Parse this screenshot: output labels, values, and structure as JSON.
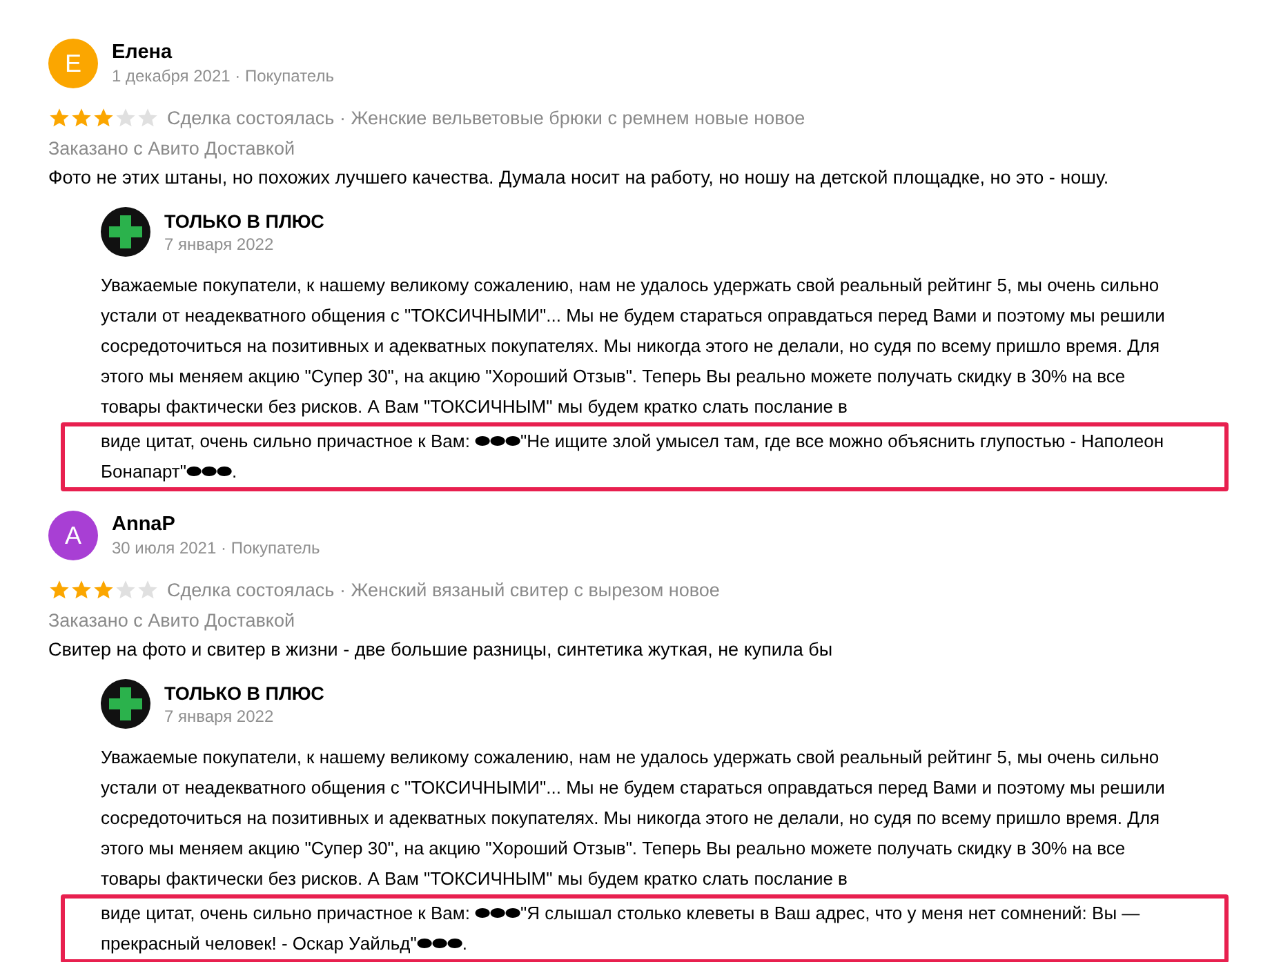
{
  "reviews": [
    {
      "author": "Елена",
      "initial": "Е",
      "color": "#fba600",
      "meta": "1 декабря 2021 · Покупатель",
      "stars": 3,
      "deal": "Сделка состоялась · Женские вельветовые брюки с ремнем новые новое",
      "delivery": "Заказано с Авито Доставкой",
      "text": "Фото не этих штаны, но похожих лучшего качества. Думала носит на работу, но ношу на детской площадке, но это - ношу.",
      "reply": {
        "author": "ТОЛЬКО В ПЛЮС",
        "date": "7 января 2022",
        "text": "Уважаемые покупатели, к нашему великому сожалению, нам не удалось удержать свой реальный рейтинг 5, мы очень сильно устали от неадекватного общения с \"ТОКСИЧНЫМИ\"... Мы не будем стараться оправдаться перед Вами и поэтому мы решили сосредоточиться на позитивных и адекватных покупателях. Мы никогда этого не делали, но судя по всему пришло время. Для этого мы меняем акцию \"Супер 30\", на акцию \"Хороший Отзыв\". Теперь Вы реально можете получать скидку в 30% на все товары фактически без рисков. А Вам \"ТОКСИЧНЫМ\" мы будем кратко слать послание в",
        "highlight": "виде цитат, очень сильно причастное к Вам: ⬬⬬⬬\"Не ищите злой умысел там, где все можно объяснить глупостью - Наполеон Бонапарт\"⬬⬬⬬."
      }
    },
    {
      "author": "AnnaP",
      "initial": "A",
      "color": "#a83fd4",
      "meta": "30 июля 2021 · Покупатель",
      "stars": 3,
      "deal": "Сделка состоялась · Женский вязаный свитер с вырезом новое",
      "delivery": "Заказано с Авито Доставкой",
      "text": "Свитер на фото и свитер в жизни - две большие разницы, синтетика жуткая, не купила бы",
      "reply": {
        "author": "ТОЛЬКО В ПЛЮС",
        "date": "7 января 2022",
        "text": "Уважаемые покупатели, к нашему великому сожалению, нам не удалось удержать свой реальный рейтинг 5, мы очень сильно устали от неадекватного общения с \"ТОКСИЧНЫМИ\"... Мы не будем стараться оправдаться перед Вами и поэтому мы решили сосредоточиться на позитивных и адекватных покупателях. Мы никогда этого не делали, но судя по всему пришло время. Для этого мы меняем акцию \"Супер 30\", на акцию \"Хороший Отзыв\". Теперь Вы реально можете получать скидку в 30% на все товары фактически без рисков. А Вам \"ТОКСИЧНЫМ\" мы будем кратко слать послание в",
        "highlight": "виде цитат, очень сильно причастное к Вам: ⬬⬬⬬\"Я слышал столько клеветы в Ваш адрес, что у меня нет сомнений: Вы — прекрасный человек! - Оскар Уайльд\"⬬⬬⬬."
      }
    }
  ]
}
